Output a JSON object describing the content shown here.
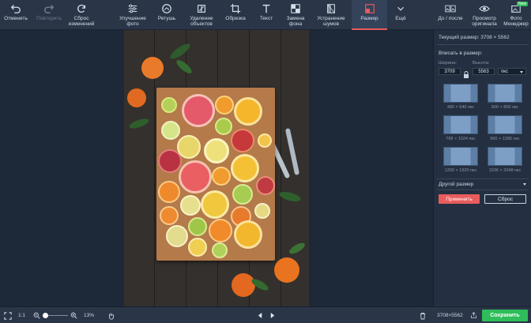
{
  "toolbar": {
    "undo": "Отменить",
    "redo": "Повторить",
    "reset_changes": "Сброс изменений",
    "enhance": "Улучшение фото",
    "retouch": "Ретушь",
    "remove_objects": "Удаление объектов",
    "crop": "Обрезка",
    "text": "Текст",
    "replace_bg": "Замена фона",
    "denoise": "Устранение шумов",
    "resize": "Размер",
    "more": "Ещё",
    "before_after": "До / после",
    "view_original": "Просмотр оригинала",
    "photo_manager": "Фото Менеджер",
    "new_badge": "New"
  },
  "panel": {
    "current_size": "Текущий размер: 3708 × 5562",
    "fit_to_size": "Вписать в размер:",
    "width_label": "Ширина:",
    "height_label": "Высота:",
    "width_value": "3709",
    "height_value": "5563",
    "unit": "пкс",
    "presets": [
      "480 × 640 пкс",
      "600 × 800 пкс",
      "768 × 1024 пкс",
      "960 × 1280 пкс",
      "1200 × 1920 пкс",
      "1536 × 2048 пкс"
    ],
    "other_size": "Другой размер",
    "apply": "Применить",
    "reset": "Сброс"
  },
  "bottombar": {
    "ratio": "1:1",
    "zoom": "13%",
    "dimensions": "3708×5562",
    "save": "Сохранить"
  },
  "colors": {
    "accent_red": "#e85c5c",
    "save_green": "#2ebd5a",
    "panel_bg": "#243041",
    "toolbar_bg": "#2a3648"
  }
}
